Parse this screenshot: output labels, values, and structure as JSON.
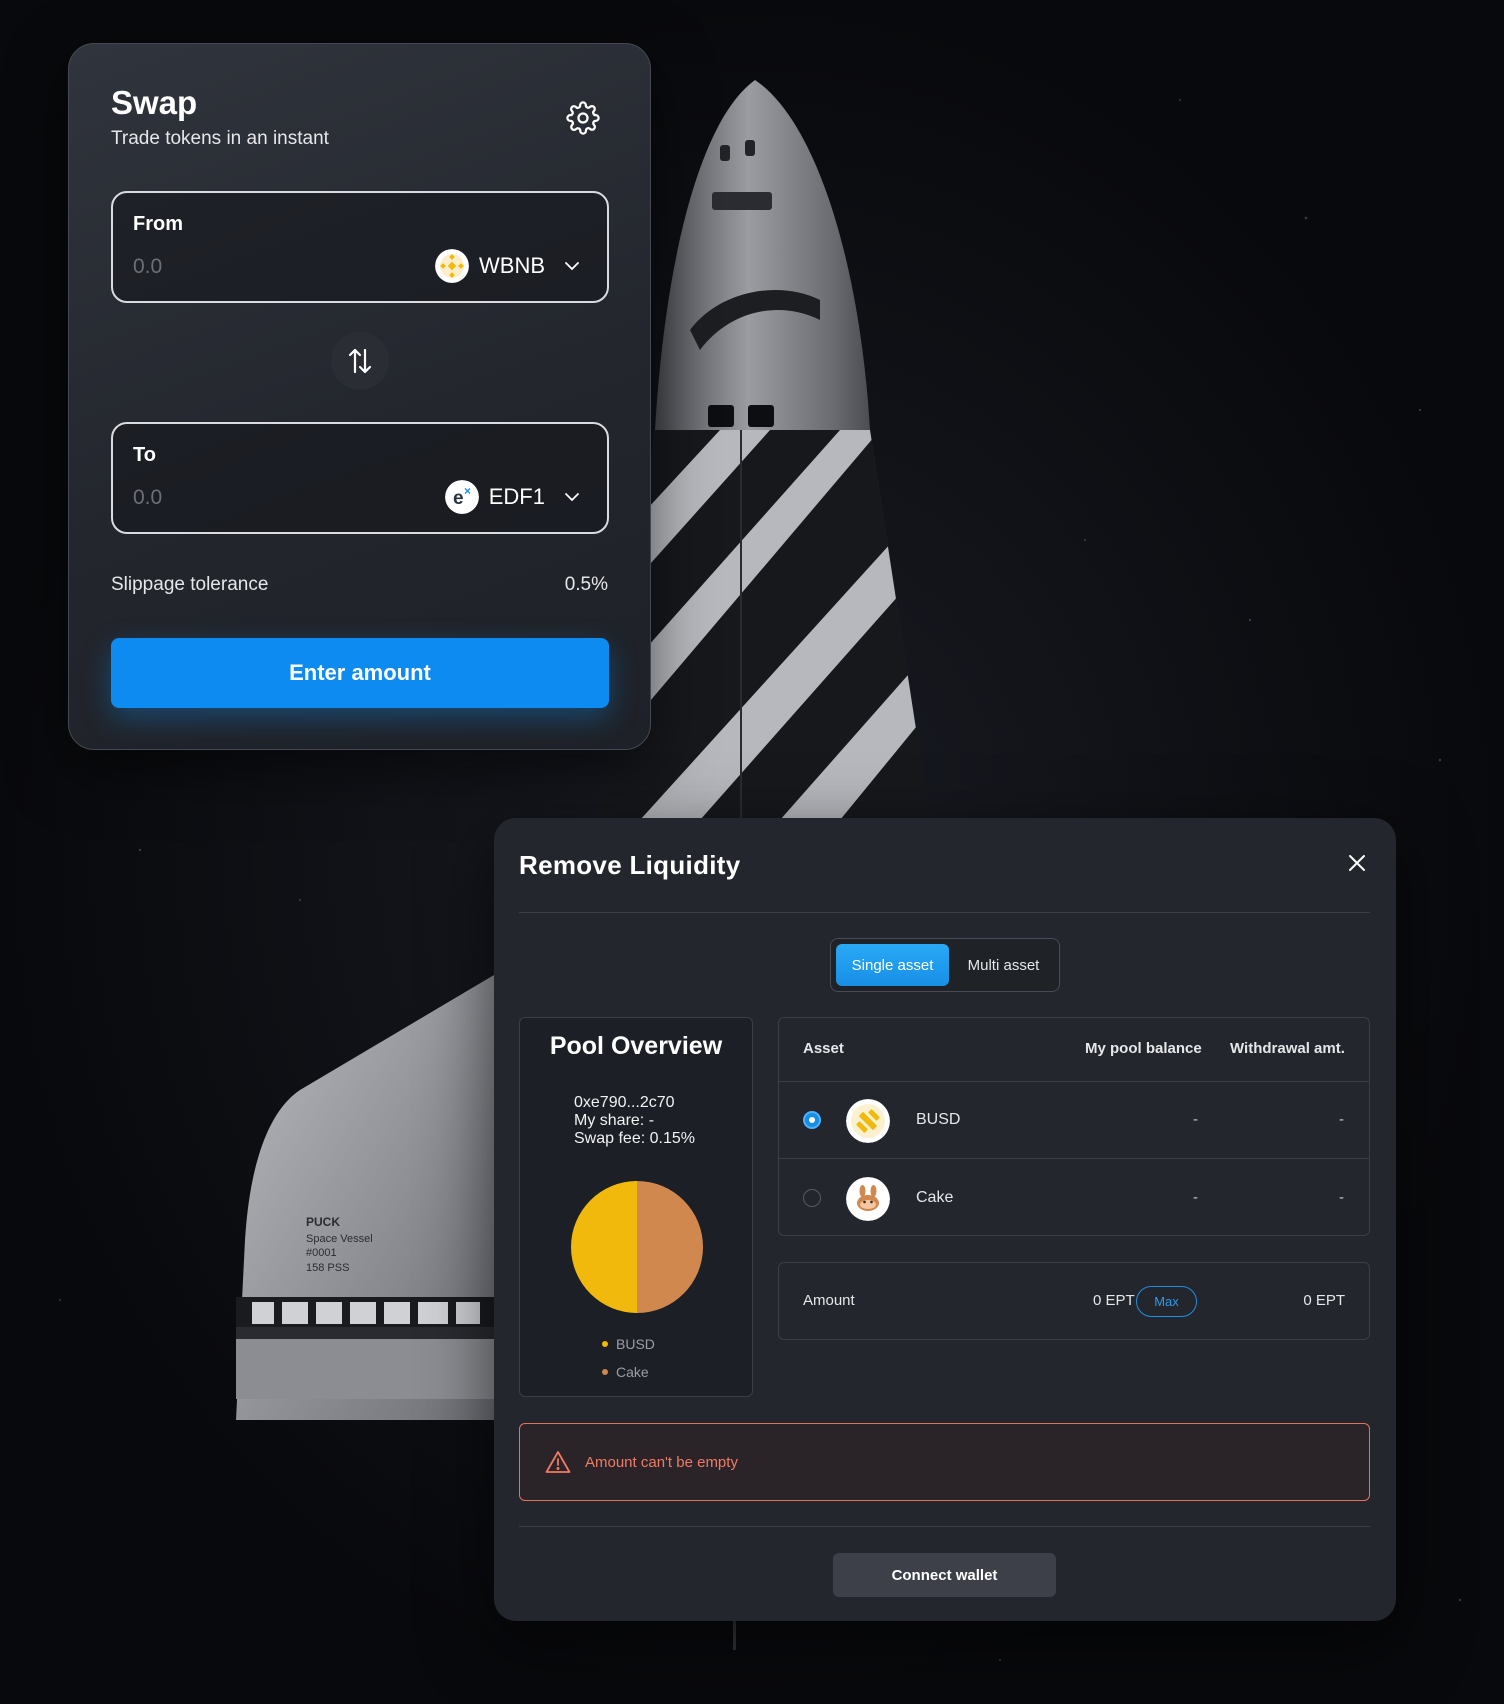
{
  "swap": {
    "title": "Swap",
    "subtitle": "Trade tokens in an instant",
    "from": {
      "label": "From",
      "amount_placeholder": "0.0",
      "token": "WBNB"
    },
    "to": {
      "label": "To",
      "amount_placeholder": "0.0",
      "token": "EDF1"
    },
    "slippage_label": "Slippage tolerance",
    "slippage_value": "0.5%",
    "submit_label": "Enter amount"
  },
  "shuttle_markings": {
    "name": "PUCK",
    "line1": "Space Vessel",
    "line2": "#0001",
    "line3": "158 PSS"
  },
  "remove_liquidity": {
    "title": "Remove Liquidity",
    "tabs": {
      "single": "Single asset",
      "multi": "Multi asset",
      "active": "single"
    },
    "pool": {
      "title": "Pool Overview",
      "address": "0xe790...2c70",
      "share": "My share: -",
      "fee": "Swap fee: 0.15%",
      "legend": [
        {
          "label": "BUSD",
          "color": "#f0b90b"
        },
        {
          "label": "Cake",
          "color": "#d1884f"
        }
      ],
      "pie_shares": [
        0.5,
        0.5
      ]
    },
    "table": {
      "headers": {
        "asset": "Asset",
        "balance": "My pool balance",
        "withdrawal": "Withdrawal amt."
      },
      "rows": [
        {
          "asset": "BUSD",
          "balance": "-",
          "withdrawal": "-",
          "selected": true
        },
        {
          "asset": "Cake",
          "balance": "-",
          "withdrawal": "-",
          "selected": false
        }
      ]
    },
    "amount": {
      "label": "Amount",
      "value": "0 EPT",
      "max_label": "Max",
      "withdrawal": "0 EPT"
    },
    "error": "Amount can't be empty",
    "connect_label": "Connect wallet"
  },
  "colors": {
    "accent": "#0d8bf0",
    "error": "#f07a66",
    "busd": "#f0b90b",
    "cake": "#d1884f"
  }
}
